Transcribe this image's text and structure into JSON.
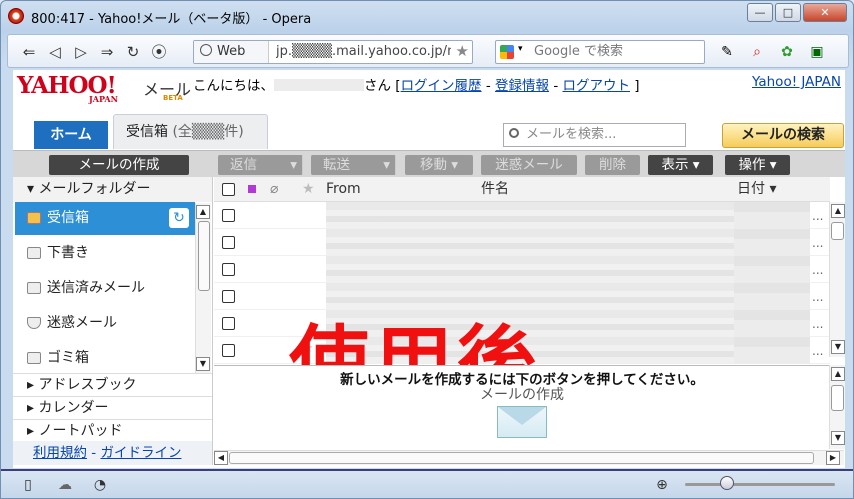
{
  "window": {
    "title": "800:417 - Yahoo!メール（ベータ版） - Opera",
    "min": "—",
    "max": "□",
    "close": "✕"
  },
  "nav": {
    "web_label": "Web",
    "url": "jp.▒▒▒▒.mail.yahoo.co.jp/m",
    "search_placeholder": "Google で検索"
  },
  "yahoo": {
    "logo": "YAHOO!",
    "logo_sub": "JAPAN",
    "mail": "メール",
    "beta": "BETA",
    "greeting_prefix": "こんにちは、",
    "greeting_suffix": "さん [",
    "login_history": "ログイン履歴",
    "sep1": " - ",
    "account_info": "登録情報",
    "sep2": " - ",
    "logout": "ログアウト",
    "greeting_end": " ]",
    "yahoo_japan": "Yahoo! JAPAN"
  },
  "tabs": {
    "home": "ホーム",
    "inbox": "受信箱",
    "inbox_count": "(全▒▒▒件)"
  },
  "search": {
    "placeholder": "メールを検索...",
    "button": "メールの検索"
  },
  "toolbar": {
    "compose": "メールの作成",
    "reply": "返信",
    "forward": "転送",
    "move": "移動 ▾",
    "spam": "迷惑メール",
    "delete": "削除",
    "view": "表示 ▾",
    "action": "操作 ▾"
  },
  "sidebar": {
    "header": "▾ メールフォルダー",
    "folders": [
      "受信箱",
      "下書き",
      "送信済みメール",
      "迷惑メール",
      "ゴミ箱"
    ],
    "links": [
      "▸ アドレスブック",
      "▸ カレンダー",
      "▸ ノートパッド"
    ],
    "terms": "利用規約",
    "sep": " - ",
    "guidelines": "ガイドライン"
  },
  "list": {
    "col_from": "From",
    "col_subject": "件名",
    "col_date": "日付 ▾",
    "overlay": "使用後",
    "ellipsis": "..."
  },
  "compose_area": {
    "message": "新しいメールを作成するには下のボタンを押してください。",
    "label": "メールの作成"
  },
  "colors": {
    "accent": "#2d8fd6",
    "overlay": "#f01010",
    "search_btn": "#f6cc5a"
  }
}
